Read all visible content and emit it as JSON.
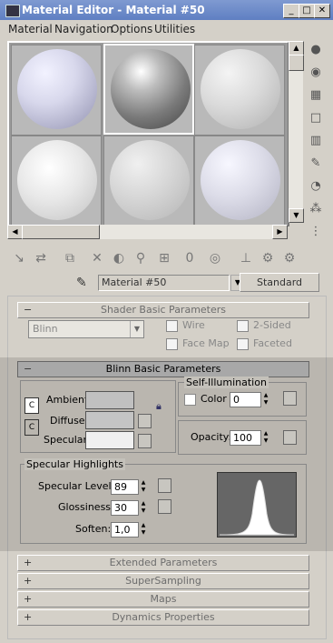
{
  "window": {
    "title": "Material Editor - Material #50"
  },
  "menu": [
    "Material",
    "Navigation",
    "Options",
    "Utilities"
  ],
  "material": {
    "name": "Material #50",
    "type_button": "Standard"
  },
  "rollouts": {
    "shader_basic": {
      "title": "Shader Basic Parameters",
      "shader": "Blinn",
      "options": [
        "Wire",
        "2-Sided",
        "Face Map",
        "Faceted"
      ]
    },
    "blinn_basic": {
      "title": "Blinn Basic Parameters",
      "self_illum_title": "Self-Illumination",
      "color_label": "Color",
      "color_value": "0",
      "ambient_label": "Ambient:",
      "diffuse_label": "Diffuse:",
      "specular_label": "Specular:",
      "opacity_label": "Opacity:",
      "opacity_value": "100",
      "spec_highlights_title": "Specular Highlights",
      "specular_level_label": "Specular Level:",
      "specular_level_value": "89",
      "glossiness_label": "Glossiness:",
      "glossiness_value": "30",
      "soften_label": "Soften:",
      "soften_value": "1,0"
    },
    "collapsed": [
      "Extended Parameters",
      "SuperSampling",
      "Maps",
      "Dynamics Properties"
    ]
  },
  "icons": [
    "sphere-icon",
    "backlight-icon",
    "checker-background-icon",
    "sample-uv-icon",
    "video-color-check-icon",
    "make-preview-icon",
    "options-icon",
    "select-by-material-icon",
    "material-navigator-icon"
  ]
}
